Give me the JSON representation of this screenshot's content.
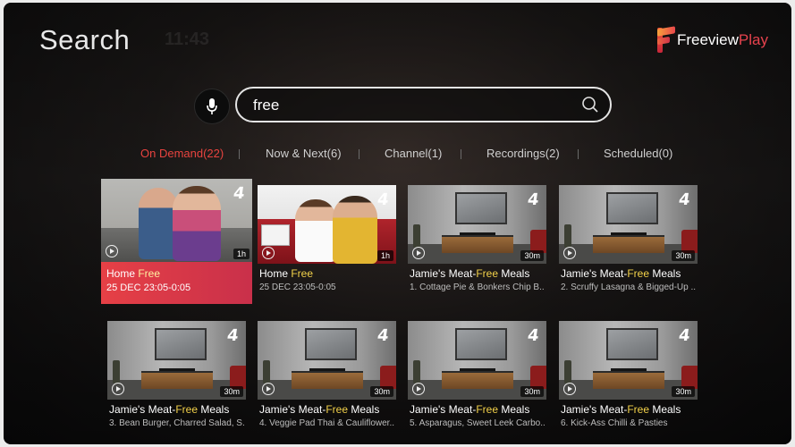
{
  "header": {
    "title": "Search",
    "ghost_text": "11:43",
    "brand_free": "Freeview",
    "brand_play": "Play"
  },
  "search": {
    "query": "free",
    "mic_icon": "microphone-icon",
    "search_icon": "magnifier-icon"
  },
  "tabs": [
    {
      "label": "On Demand(22)"
    },
    {
      "label": "Now & Next(6)"
    },
    {
      "label": "Channel(1)"
    },
    {
      "label": "Recordings(2)"
    },
    {
      "label": "Scheduled(0)"
    }
  ],
  "results": [
    {
      "title_pre": "Home ",
      "title_hl": "Free",
      "title_post": "",
      "subtitle": "25 DEC 23:05-0:05",
      "duration": "1h",
      "channel": "4"
    },
    {
      "title_pre": "Home ",
      "title_hl": "Free",
      "title_post": "",
      "subtitle": "25 DEC 23:05-0:05",
      "duration": "1h",
      "channel": "4"
    },
    {
      "title_pre": "Jamie's Meat-",
      "title_hl": "Free",
      "title_post": " Meals",
      "subtitle": "1. Cottage Pie & Bonkers Chip B...",
      "duration": "30m",
      "channel": "4"
    },
    {
      "title_pre": "Jamie's Meat-",
      "title_hl": "Free",
      "title_post": " Meals",
      "subtitle": "2. Scruffy Lasagna & Bigged-Up ...",
      "duration": "30m",
      "channel": "4"
    },
    {
      "title_pre": "Jamie's Meat-",
      "title_hl": "Free",
      "title_post": " Meals",
      "subtitle": "3. Bean Burger, Charred Salad, S...",
      "duration": "30m",
      "channel": "4"
    },
    {
      "title_pre": "Jamie's Meat-",
      "title_hl": "Free",
      "title_post": " Meals",
      "subtitle": "4. Veggie Pad Thai & Cauliflower...",
      "duration": "30m",
      "channel": "4"
    },
    {
      "title_pre": "Jamie's Meat-",
      "title_hl": "Free",
      "title_post": " Meals",
      "subtitle": "5. Asparagus, Sweet Leek Carbo...",
      "duration": "30m",
      "channel": "4"
    },
    {
      "title_pre": "Jamie's Meat-",
      "title_hl": "Free",
      "title_post": " Meals",
      "subtitle": "6. Kick-Ass Chilli & Pasties",
      "duration": "30m",
      "channel": "4"
    }
  ],
  "colors": {
    "accent": "#e64046",
    "highlight": "#f3d24a"
  }
}
